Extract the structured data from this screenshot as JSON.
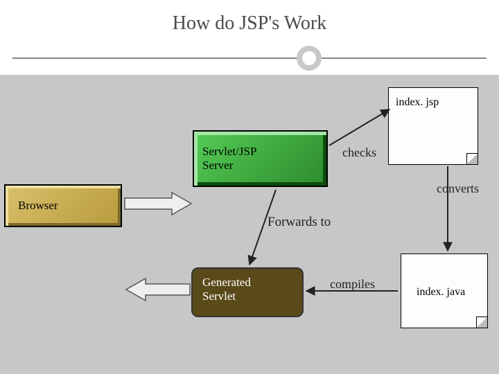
{
  "title": "How do JSP's Work",
  "nodes": {
    "browser": "Browser",
    "server": "Servlet/JSP\nServer",
    "generated_servlet": "Generated\nServlet",
    "doc_jsp": "index. jsp",
    "doc_java": "index. java"
  },
  "edges": {
    "checks": "checks",
    "converts": "converts",
    "forwards": "Forwards to",
    "compiles": "compiles"
  }
}
